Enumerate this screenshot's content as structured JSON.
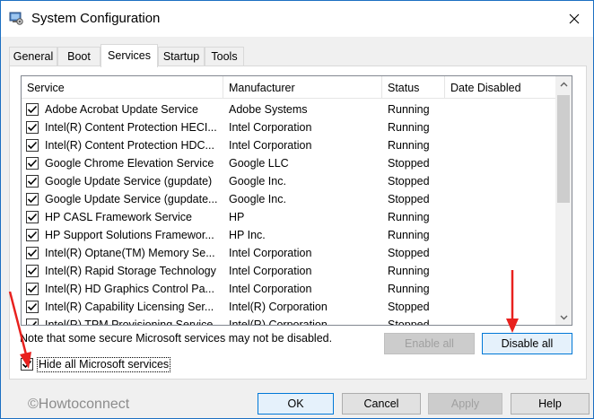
{
  "window": {
    "title": "System Configuration",
    "accent_color": "#1c6fc2"
  },
  "tabs": [
    {
      "label": "General"
    },
    {
      "label": "Boot"
    },
    {
      "label": "Services",
      "active": true
    },
    {
      "label": "Startup"
    },
    {
      "label": "Tools"
    }
  ],
  "table": {
    "columns": [
      "Service",
      "Manufacturer",
      "Status",
      "Date Disabled"
    ],
    "rows": [
      {
        "service": "Adobe Acrobat Update Service",
        "manufacturer": "Adobe Systems",
        "status": "Running",
        "checked": true
      },
      {
        "service": "Intel(R) Content Protection HECI...",
        "manufacturer": "Intel Corporation",
        "status": "Running",
        "checked": true
      },
      {
        "service": "Intel(R) Content Protection HDC...",
        "manufacturer": "Intel Corporation",
        "status": "Running",
        "checked": true
      },
      {
        "service": "Google Chrome Elevation Service",
        "manufacturer": "Google LLC",
        "status": "Stopped",
        "checked": true
      },
      {
        "service": "Google Update Service (gupdate)",
        "manufacturer": "Google Inc.",
        "status": "Stopped",
        "checked": true
      },
      {
        "service": "Google Update Service (gupdate...",
        "manufacturer": "Google Inc.",
        "status": "Stopped",
        "checked": true
      },
      {
        "service": "HP CASL Framework Service",
        "manufacturer": "HP",
        "status": "Running",
        "checked": true
      },
      {
        "service": "HP Support Solutions Framewor...",
        "manufacturer": "HP Inc.",
        "status": "Running",
        "checked": true
      },
      {
        "service": "Intel(R) Optane(TM) Memory Se...",
        "manufacturer": "Intel Corporation",
        "status": "Stopped",
        "checked": true
      },
      {
        "service": "Intel(R) Rapid Storage Technology",
        "manufacturer": "Intel Corporation",
        "status": "Running",
        "checked": true
      },
      {
        "service": "Intel(R) HD Graphics Control Pa...",
        "manufacturer": "Intel Corporation",
        "status": "Running",
        "checked": true
      },
      {
        "service": "Intel(R) Capability Licensing Ser...",
        "manufacturer": "Intel(R) Corporation",
        "status": "Stopped",
        "checked": true
      },
      {
        "service": "Intel(R) TPM Provisioning Service",
        "manufacturer": "Intel(R) Corporation",
        "status": "Stopped",
        "checked": true
      }
    ]
  },
  "note": "Note that some secure Microsoft services may not be disabled.",
  "buttons": {
    "enable_all": "Enable all",
    "disable_all": "Disable all",
    "ok": "OK",
    "cancel": "Cancel",
    "apply": "Apply",
    "help": "Help"
  },
  "hide_ms": {
    "label": "Hide all Microsoft services",
    "checked": true
  },
  "watermark": "©Howtoconnect",
  "annotation_color": "#e8211e"
}
